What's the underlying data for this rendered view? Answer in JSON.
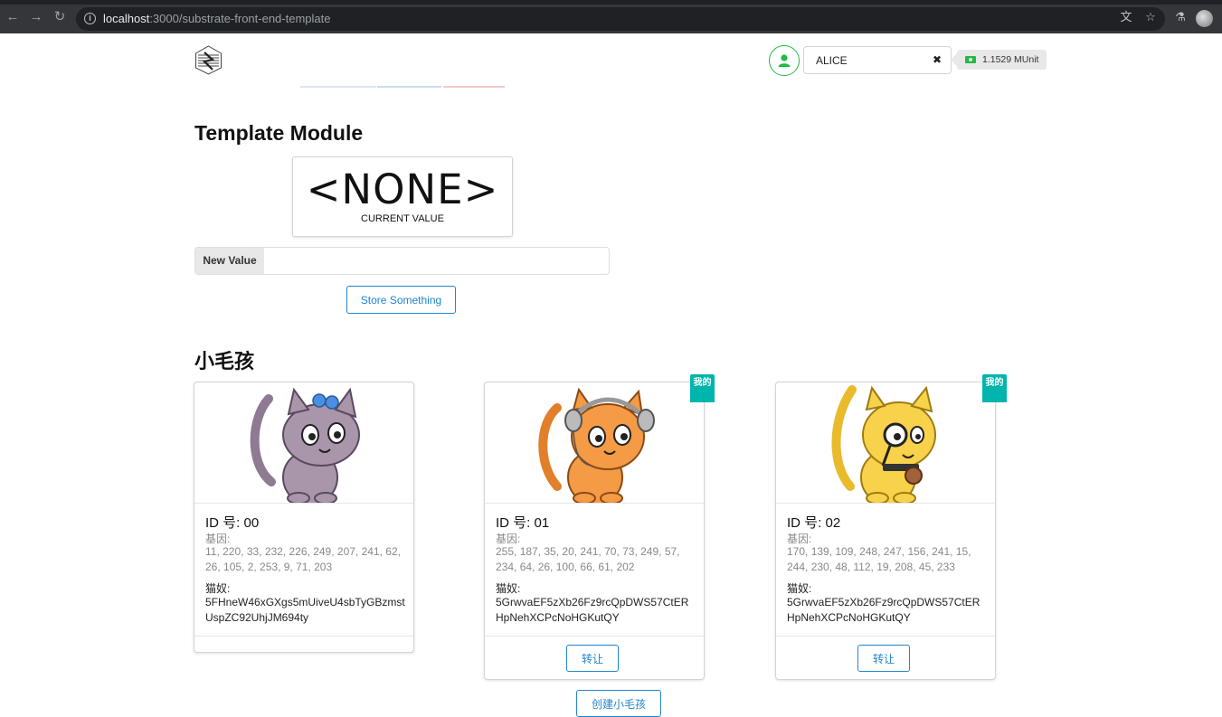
{
  "browser": {
    "url_host": "localhost",
    "url_path": ":3000/substrate-front-end-template"
  },
  "topbar": {
    "account": "ALICE",
    "clear_glyph": "✖",
    "balance": "1.1529 MUnit"
  },
  "template_module": {
    "title": "Template Module",
    "current_value": "<NONE>",
    "current_value_label": "CURRENT VALUE",
    "input_label": "New Value",
    "input_value": "",
    "store_button": "Store Something"
  },
  "kitties": {
    "title": "小毛孩",
    "mine_label": "我的",
    "gene_label": "基因:",
    "owner_label": "猫奴:",
    "transfer_label": "转让",
    "create_button": "创建小毛孩",
    "items": [
      {
        "id": "ID 号: 00",
        "genes": "11, 220, 33, 232, 226, 249, 207, 241, 62, 26, 105, 2, 253, 9, 71, 203",
        "owner": "5FHneW46xGXgs5mUiveU4sbTyGBzmstUspZC92UhjJM694ty",
        "mine": false,
        "body_color": "#a996ab"
      },
      {
        "id": "ID 号: 01",
        "genes": "255, 187, 35, 20, 241, 70, 73, 249, 57, 234, 64, 26, 100, 66, 61, 202",
        "owner": "5GrwvaEF5zXb26Fz9rcQpDWS57CtERHpNehXCPcNoHGKutQY",
        "mine": true,
        "body_color": "#f59a45"
      },
      {
        "id": "ID 号: 02",
        "genes": "170, 139, 109, 248, 247, 156, 241, 15, 244, 230, 48, 112, 19, 208, 45, 233",
        "owner": "5GrwvaEF5zXb26Fz9rcQpDWS57CtERHpNehXCPcNoHGKutQY",
        "mine": true,
        "body_color": "#f7d24a"
      }
    ]
  }
}
